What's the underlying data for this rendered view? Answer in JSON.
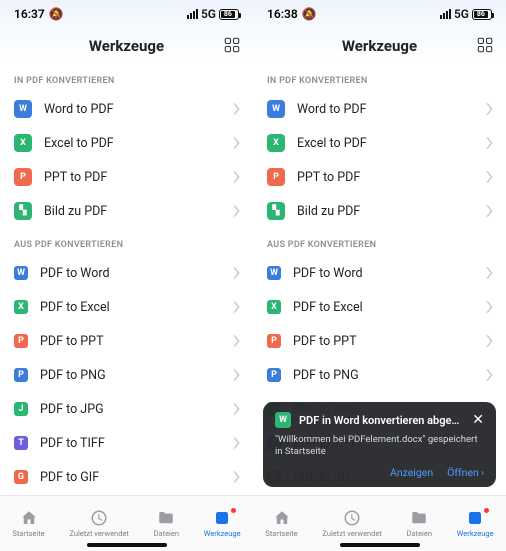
{
  "status": {
    "time_left": "16:37",
    "time_right": "16:38",
    "net": "5G",
    "battery": "86"
  },
  "header": {
    "title": "Werkzeuge"
  },
  "sections": {
    "inpdf": {
      "title": "IN PDF KONVERTIEREN",
      "items": [
        {
          "label": "Word to PDF",
          "glyph": "W",
          "color": "#3b7ddd"
        },
        {
          "label": "Excel to PDF",
          "glyph": "X",
          "color": "#2bb673"
        },
        {
          "label": "PPT to PDF",
          "glyph": "P",
          "color": "#ef6a4c"
        },
        {
          "label": "Bild zu PDF",
          "glyph": "▚",
          "color": "#2bb673"
        }
      ]
    },
    "auspdf": {
      "title": "AUS PDF KONVERTIEREN",
      "items": [
        {
          "label": "PDF to Word",
          "glyph": "W",
          "color": "#3b7ddd"
        },
        {
          "label": "PDF to Excel",
          "glyph": "X",
          "color": "#2bb673"
        },
        {
          "label": "PDF to PPT",
          "glyph": "P",
          "color": "#ef6a4c"
        },
        {
          "label": "PDF to PNG",
          "glyph": "P",
          "color": "#3b7ddd"
        },
        {
          "label": "PDF to JPG",
          "glyph": "J",
          "color": "#2bb673"
        },
        {
          "label": "PDF to TIFF",
          "glyph": "T",
          "color": "#6a5de0"
        },
        {
          "label": "PDF to GIF",
          "glyph": "G",
          "color": "#ef6a4c"
        }
      ]
    }
  },
  "tabs": [
    {
      "label": "Startseite"
    },
    {
      "label": "Zuletzt verwendet"
    },
    {
      "label": "Dateien"
    },
    {
      "label": "Werkzeuge"
    }
  ],
  "toast": {
    "title": "PDF in Word konvertieren abgeschlos…",
    "body": "\"Willkommen bei PDFelement.docx\" gespeichert in Startseite",
    "action_view": "Anzeigen",
    "action_open": "Öffnen"
  }
}
